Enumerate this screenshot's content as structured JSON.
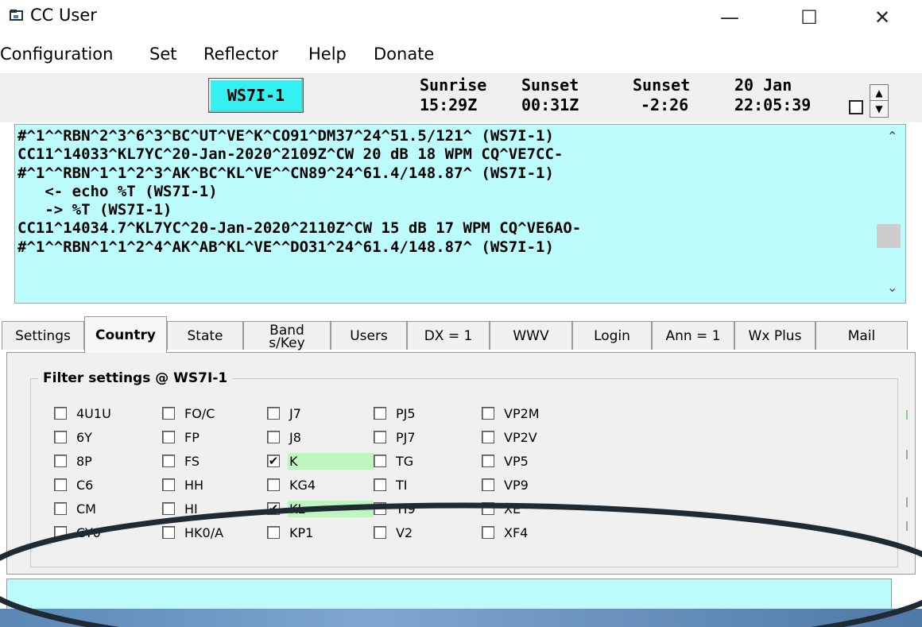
{
  "window": {
    "title": "CC User",
    "controls": {
      "minimize": "—",
      "maximize": "☐",
      "close": "✕"
    }
  },
  "menu": [
    "Configuration",
    "Set",
    "Reflector",
    "Help",
    "Donate"
  ],
  "header": {
    "node_button": "WS7I-1",
    "sunrise_label": "Sunrise",
    "sunrise_time": "15:29Z",
    "sunset_label": "Sunset",
    "sunset_time": "00:31Z",
    "sunset_rel_label": "Sunset",
    "sunset_rel_time": "-2:26",
    "date": "20 Jan",
    "clock": "22:05:39"
  },
  "console": {
    "lines": [
      "#^1^^RBN^2^3^6^3^BC^UT^VE^K^CO91^DM37^24^51.5/121^ (WS7I-1)",
      "CC11^14033^KL7YC^20-Jan-2020^2109Z^CW 20 dB 18 WPM CQ^VE7CC-",
      "#^1^^RBN^1^1^2^3^AK^BC^KL^VE^^CN89^24^61.4/148.87^ (WS7I-1)",
      "   <- echo %T (WS7I-1)",
      "   -> %T (WS7I-1)",
      "CC11^14034.7^KL7YC^20-Jan-2020^2110Z^CW 15 dB 17 WPM CQ^VE6AO-",
      "#^1^^RBN^1^1^2^4^AK^AB^KL^VE^^DO31^24^61.4/148.87^ (WS7I-1)"
    ]
  },
  "tabs": [
    "Settings",
    "Country",
    "State",
    "Band\ns/Key",
    "Users",
    "DX = 1",
    "WWV",
    "Login",
    "Ann = 1",
    "Wx Plus",
    "Mail"
  ],
  "active_tab": "Country",
  "filter": {
    "title": "Filter settings @ WS7I-1",
    "columns": [
      [
        {
          "label": "4U1U",
          "checked": false
        },
        {
          "label": "6Y",
          "checked": false
        },
        {
          "label": "8P",
          "checked": false
        },
        {
          "label": "C6",
          "checked": false
        },
        {
          "label": "CM",
          "checked": false
        },
        {
          "label": "CY0",
          "checked": false
        }
      ],
      [
        {
          "label": "FO/C",
          "checked": false
        },
        {
          "label": "FP",
          "checked": false
        },
        {
          "label": "FS",
          "checked": false
        },
        {
          "label": "HH",
          "checked": false
        },
        {
          "label": "HI",
          "checked": false
        },
        {
          "label": "HK0/A",
          "checked": false
        }
      ],
      [
        {
          "label": "J7",
          "checked": false
        },
        {
          "label": "J8",
          "checked": false
        },
        {
          "label": "K",
          "checked": true
        },
        {
          "label": "KG4",
          "checked": false
        },
        {
          "label": "KL",
          "checked": true
        },
        {
          "label": "KP1",
          "checked": false
        }
      ],
      [
        {
          "label": "PJ5",
          "checked": false
        },
        {
          "label": "PJ7",
          "checked": false
        },
        {
          "label": "TG",
          "checked": false
        },
        {
          "label": "TI",
          "checked": false
        },
        {
          "label": "TI9",
          "checked": false
        },
        {
          "label": "V2",
          "checked": false
        }
      ],
      [
        {
          "label": "VP2M",
          "checked": false
        },
        {
          "label": "VP2V",
          "checked": false
        },
        {
          "label": "VP5",
          "checked": false
        },
        {
          "label": "VP9",
          "checked": false
        },
        {
          "label": "XE",
          "checked": false
        },
        {
          "label": "XF4",
          "checked": false
        }
      ]
    ]
  },
  "command_input": {
    "value": ""
  },
  "colors": {
    "console_bg": "#bdfcfc",
    "node_button": "#35f0f0",
    "checked_highlight": "#bff5bf",
    "annotation": "#1f2a33"
  }
}
